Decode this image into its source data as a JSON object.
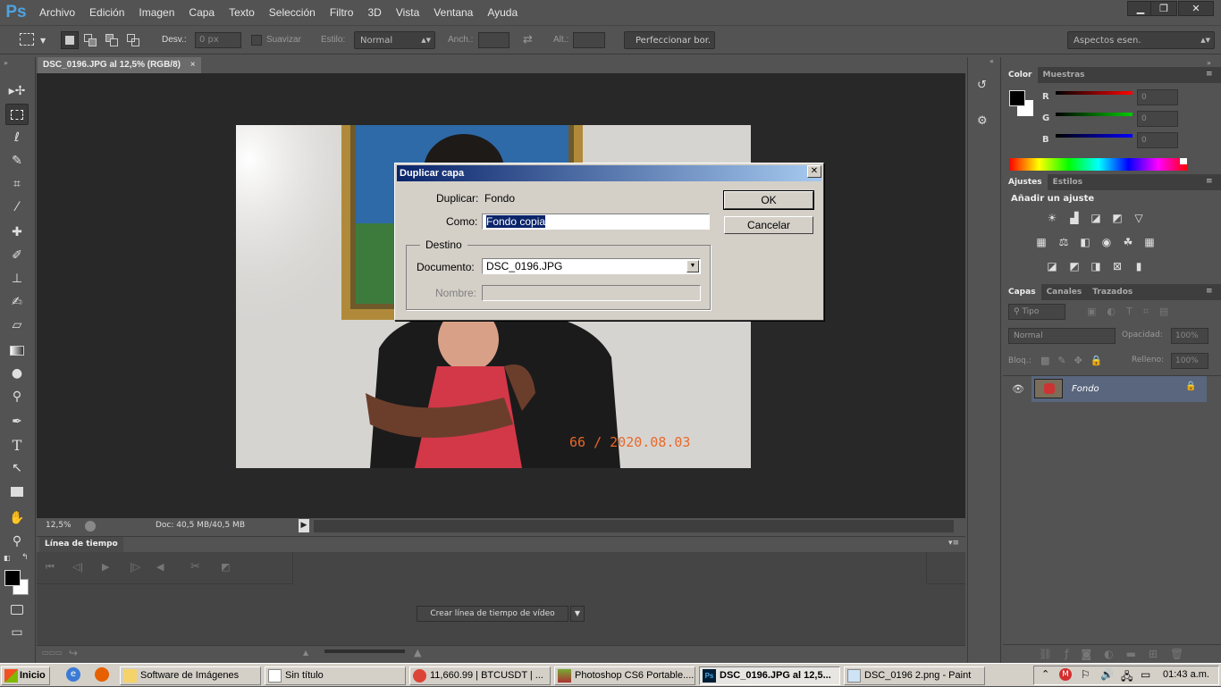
{
  "app": {
    "logo": "Ps"
  },
  "menu": [
    "Archivo",
    "Edición",
    "Imagen",
    "Capa",
    "Texto",
    "Selección",
    "Filtro",
    "3D",
    "Vista",
    "Ventana",
    "Ayuda"
  ],
  "window_controls": {
    "minimize": "▁",
    "restore": "❐",
    "close": "✕"
  },
  "options": {
    "feather_label": "Desv.:",
    "feather_value": "0 px",
    "smooth_label": "Suavizar",
    "style_label": "Estilo:",
    "style_value": "Normal",
    "width_label": "Anch.:",
    "height_label": "Alt.:",
    "refine_button": "Perfeccionar bor.",
    "workspace": "Aspectos esen."
  },
  "document": {
    "tab_title": "DSC_0196.JPG al 12,5% (RGB/8)",
    "close": "×",
    "photo_stamp": "66 / 2020.08.03",
    "zoom": "12,5%",
    "doc_info": "Doc: 40,5 MB/40,5 MB"
  },
  "timeline": {
    "tab": "Línea de tiempo",
    "create_button": "Crear línea de tiempo de vídeo"
  },
  "color_panel": {
    "tabs": [
      "Color",
      "Muestras"
    ],
    "channels": [
      {
        "label": "R",
        "value": "0",
        "color": "#ff0000"
      },
      {
        "label": "G",
        "value": "0",
        "color": "#00c000"
      },
      {
        "label": "B",
        "value": "0",
        "color": "#0000ff"
      }
    ]
  },
  "adjust_panel": {
    "tabs": [
      "Ajustes",
      "Estilos"
    ],
    "heading": "Añadir un ajuste"
  },
  "layers_panel": {
    "tabs": [
      "Capas",
      "Canales",
      "Trazados"
    ],
    "filter": "Tipo",
    "blend_mode": "Normal",
    "opacity_label": "Opacidad:",
    "opacity_value": "100%",
    "lock_label": "Bloq.:",
    "fill_label": "Relleno:",
    "fill_value": "100%",
    "layers": [
      {
        "name": "Fondo"
      }
    ]
  },
  "dialog": {
    "title": "Duplicar capa",
    "duplicate_label": "Duplicar:",
    "duplicate_value": "Fondo",
    "as_label": "Como:",
    "as_value": "Fondo copia",
    "group_label": "Destino",
    "document_label": "Documento:",
    "document_value": "DSC_0196.JPG",
    "name_label": "Nombre:",
    "ok": "OK",
    "cancel": "Cancelar",
    "close": "✕"
  },
  "taskbar": {
    "start": "Inicio",
    "items": [
      "Software de Imágenes",
      "Sin título",
      "11,660.99 | BTCUSDT | ...",
      "Photoshop CS6 Portable....",
      "DSC_0196.JPG al 12,5...",
      "DSC_0196 2.png - Paint"
    ],
    "clock": "01:43 a.m."
  },
  "colors": {
    "accent": "#0a246a",
    "panel": "#535353",
    "canvas": "#282828",
    "stamp": "#e8692a"
  }
}
